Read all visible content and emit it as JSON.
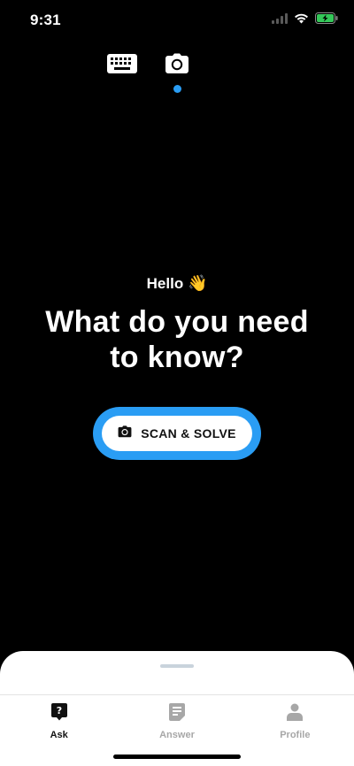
{
  "status_bar": {
    "time": "9:31"
  },
  "mode_switch": {
    "keyboard_icon": "keyboard-icon",
    "camera_icon": "camera-icon",
    "active": "camera"
  },
  "hero": {
    "greeting": "Hello",
    "greeting_emoji": "👋",
    "headline_line1": "What do you need",
    "headline_line2": "to know?"
  },
  "scan_button": {
    "label": "SCAN & SOLVE",
    "icon": "camera-icon"
  },
  "tabs": [
    {
      "label": "Ask",
      "icon": "question-bubble-icon",
      "active": true
    },
    {
      "label": "Answer",
      "icon": "document-icon",
      "active": false
    },
    {
      "label": "Profile",
      "icon": "person-icon",
      "active": false
    }
  ],
  "colors": {
    "accent": "#2a9df4",
    "background": "#000000",
    "sheet": "#ffffff",
    "battery": "#34c759",
    "tab_inactive": "#a7a7a7"
  }
}
